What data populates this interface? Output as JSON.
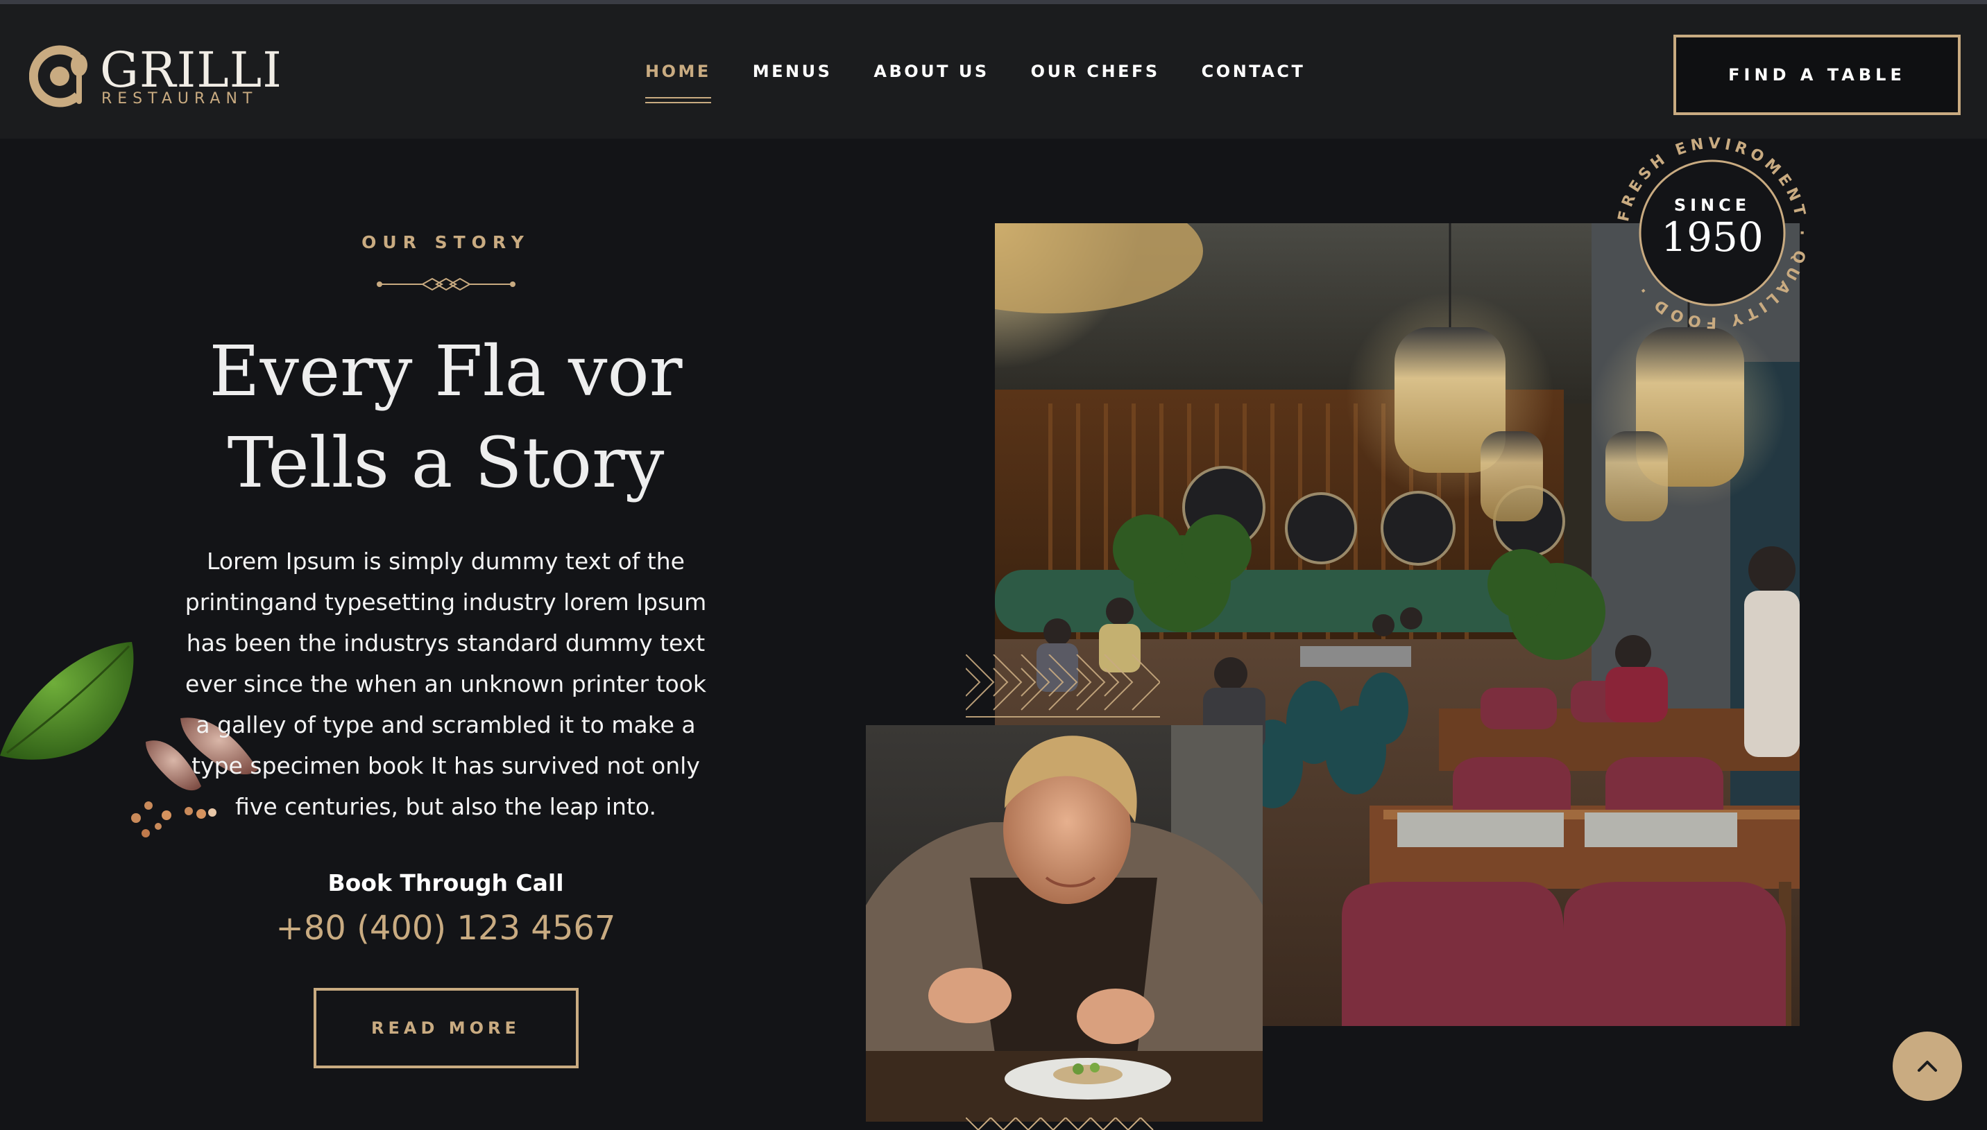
{
  "brand": {
    "name": "GRILLI",
    "subtitle": "RESTAURANT",
    "accent_color": "#c9ab81"
  },
  "nav": {
    "items": [
      {
        "label": "HOME",
        "active": true
      },
      {
        "label": "MENUS",
        "active": false
      },
      {
        "label": "ABOUT US",
        "active": false
      },
      {
        "label": "OUR CHEFS",
        "active": false
      },
      {
        "label": "CONTACT",
        "active": false
      }
    ],
    "cta_label": "FIND A TABLE"
  },
  "story": {
    "eyebrow": "OUR STORY",
    "headline_line1": "Every Fla vor",
    "headline_line2": "Tells a Story",
    "body": "Lorem Ipsum is simply dummy text of the printingand typesetting industry lorem Ipsum has been the industrys standard dummy text ever since the when an unknown printer took a galley of type and scrambled it to make a type specimen book It has survived not only five centuries, but also the leap into.",
    "book_label": "Book Through Call",
    "phone": "+80 (400) 123 4567",
    "read_more_label": "READ MORE"
  },
  "badge": {
    "ring_text": "FRESH ENVIROMENT · QUALITY FOOD ·",
    "since_label": "SINCE",
    "year": "1950"
  },
  "icons": {
    "scroll_top": "chevron-up-icon",
    "logo": "plate-spoon-icon"
  }
}
